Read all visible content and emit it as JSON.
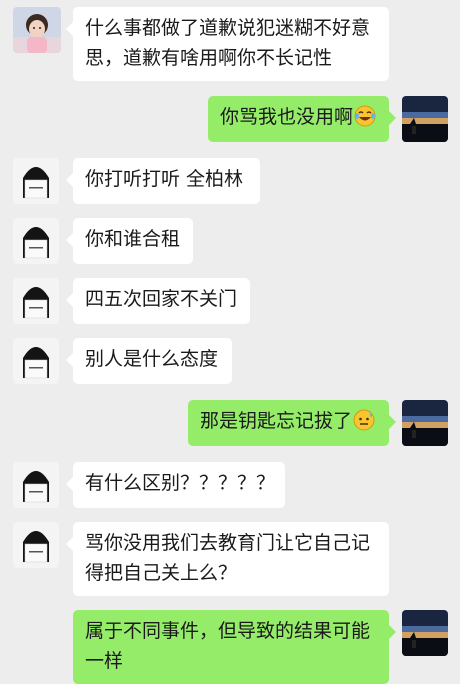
{
  "colors": {
    "background": "#ededed",
    "bubble_incoming": "#ffffff",
    "bubble_outgoing": "#95ec69",
    "text": "#1a1a1a"
  },
  "avatars": {
    "contact_first": "child-photo-avatar",
    "contact": "person-with-sign-avatar",
    "self": "sunset-landscape-avatar"
  },
  "messages": [
    {
      "from": "contact",
      "text": "什么事都做了道歉说犯迷糊不好意思，道歉有啥用啊你不长记性",
      "line1": "什么事都做了道歉说犯迷糊不好意",
      "line2": "思，道歉有啥用啊你不长记性"
    },
    {
      "from": "self",
      "text": "你骂我也没用啊",
      "emoji": "laughing-tears-emoji"
    },
    {
      "from": "contact",
      "text": "你打听打听 全柏林"
    },
    {
      "from": "contact",
      "text": "你和谁合租"
    },
    {
      "from": "contact",
      "text": "四五次回家不关门"
    },
    {
      "from": "contact",
      "text": "别人是什么态度"
    },
    {
      "from": "self",
      "text": "那是钥匙忘记拔了",
      "emoji": "awkward-sweat-emoji"
    },
    {
      "from": "contact",
      "text": "有什么区别？？？？？"
    },
    {
      "from": "contact",
      "text": "骂你没用我们去教育门让它自己记得把自己关上么？",
      "line1": "骂你没用我们去教育门让它自己记",
      "line2": "得把自己关上么？"
    },
    {
      "from": "self",
      "text": "属于不同事件，但导致的结果可能一样",
      "line1": "属于不同事件，但导致的结果可能",
      "line2": "一样"
    }
  ]
}
